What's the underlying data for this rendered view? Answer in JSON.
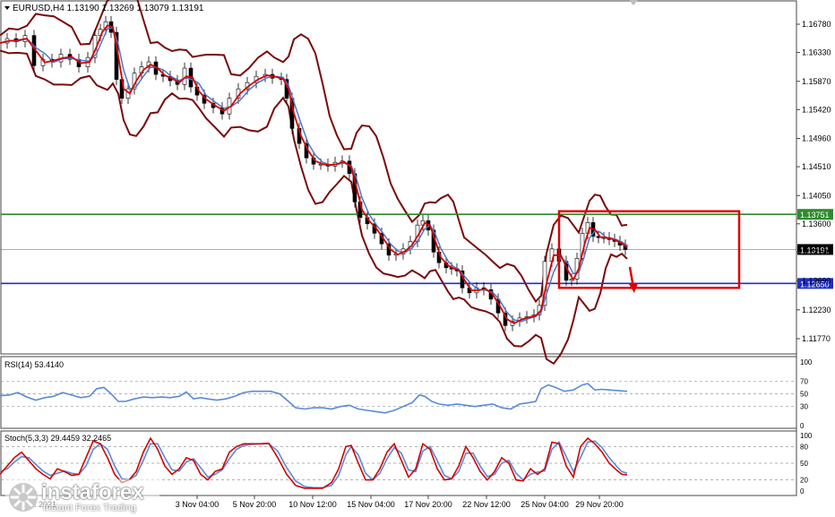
{
  "chart_data": {
    "type": "candlestick",
    "symbol": "EURUSD",
    "timeframe": "H4",
    "header": "EURUSD,H4  1.13190 1.13269 1.13079 1.13191",
    "ylim": [
      1.1157,
      1.1708
    ],
    "y_ticks": [
      "1.16780",
      "1.16330",
      "1.15870",
      "1.15420",
      "1.14960",
      "1.14510",
      "1.14050",
      "1.13600",
      "1.13150",
      "1.12690",
      "1.12230",
      "1.11770"
    ],
    "x_ticks": [
      "29 Oct 2021",
      "3 Nov 04:00",
      "5 Nov 20:00",
      "10 Nov 12:00",
      "15 Nov 04:00",
      "17 Nov 20:00",
      "22 Nov 12:00",
      "25 Nov 04:00",
      "29 Nov 20:00"
    ],
    "x_tick_positions": [
      14,
      220,
      284,
      349,
      414,
      478,
      543,
      608,
      669
    ],
    "price_series": [
      [
        0,
        1.1648
      ],
      [
        10,
        1.1655
      ],
      [
        20,
        1.165
      ],
      [
        30,
        1.166
      ],
      [
        40,
        1.1612
      ],
      [
        50,
        1.1622
      ],
      [
        60,
        1.1618
      ],
      [
        70,
        1.163
      ],
      [
        80,
        1.1622
      ],
      [
        90,
        1.161
      ],
      [
        100,
        1.1625
      ],
      [
        108,
        1.166
      ],
      [
        114,
        1.167
      ],
      [
        120,
        1.1682
      ],
      [
        126,
        1.1665
      ],
      [
        132,
        1.159
      ],
      [
        138,
        1.156
      ],
      [
        145,
        1.1575
      ],
      [
        152,
        1.16
      ],
      [
        160,
        1.161
      ],
      [
        168,
        1.1618
      ],
      [
        176,
        1.1598
      ],
      [
        184,
        1.1595
      ],
      [
        192,
        1.1588
      ],
      [
        200,
        1.1582
      ],
      [
        208,
        1.1608
      ],
      [
        215,
        1.1578
      ],
      [
        222,
        1.1565
      ],
      [
        230,
        1.1552
      ],
      [
        240,
        1.1545
      ],
      [
        250,
        1.1535
      ],
      [
        258,
        1.156
      ],
      [
        268,
        1.1575
      ],
      [
        278,
        1.1585
      ],
      [
        288,
        1.1595
      ],
      [
        298,
        1.1598
      ],
      [
        306,
        1.1592
      ],
      [
        316,
        1.159
      ],
      [
        322,
        1.156
      ],
      [
        328,
        1.1512
      ],
      [
        336,
        1.1488
      ],
      [
        344,
        1.1465
      ],
      [
        352,
        1.1455
      ],
      [
        360,
        1.1455
      ],
      [
        368,
        1.1452
      ],
      [
        376,
        1.1458
      ],
      [
        384,
        1.146
      ],
      [
        392,
        1.144
      ],
      [
        398,
        1.1395
      ],
      [
        404,
        1.137
      ],
      [
        412,
        1.136
      ],
      [
        420,
        1.1345
      ],
      [
        428,
        1.1328
      ],
      [
        436,
        1.131
      ],
      [
        444,
        1.1312
      ],
      [
        452,
        1.132
      ],
      [
        460,
        1.1332
      ],
      [
        468,
        1.1358
      ],
      [
        474,
        1.1365
      ],
      [
        480,
        1.135
      ],
      [
        486,
        1.1315
      ],
      [
        492,
        1.1298
      ],
      [
        500,
        1.129
      ],
      [
        506,
        1.1288
      ],
      [
        512,
        1.1285
      ],
      [
        518,
        1.1258
      ],
      [
        526,
        1.125
      ],
      [
        534,
        1.1258
      ],
      [
        542,
        1.1255
      ],
      [
        550,
        1.124
      ],
      [
        558,
        1.1218
      ],
      [
        566,
        1.1198
      ],
      [
        574,
        1.1205
      ],
      [
        582,
        1.121
      ],
      [
        590,
        1.1212
      ],
      [
        598,
        1.1215
      ],
      [
        604,
        1.123
      ],
      [
        610,
        1.13
      ],
      [
        618,
        1.132
      ],
      [
        626,
        1.13
      ],
      [
        634,
        1.127
      ],
      [
        640,
        1.1272
      ],
      [
        646,
        1.1305
      ],
      [
        652,
        1.1345
      ],
      [
        658,
        1.1362
      ],
      [
        664,
        1.134
      ],
      [
        670,
        1.1338
      ],
      [
        676,
        1.1338
      ],
      [
        682,
        1.1335
      ],
      [
        688,
        1.1332
      ],
      [
        694,
        1.1326
      ],
      [
        700,
        1.1319
      ]
    ],
    "horizontal_levels": [
      {
        "value": 1.13751,
        "label": "1.13751",
        "color": "#2e8b2e"
      },
      {
        "value": 1.1265,
        "label": "1.12650",
        "color": "#1f2ec8"
      },
      {
        "value": 1.13191,
        "label": "1.13191",
        "color": "#000000"
      }
    ],
    "indicators": [
      "Bollinger Bands",
      "moving average (red)",
      "moving average (blue)"
    ],
    "colors": {
      "bollinger": "#7a0a0a",
      "ma_fast": "#d40000",
      "ma_slow": "#4a78c8",
      "annotation": "#e00000",
      "support": "#1f2ec8",
      "resistance": "#2e8b2e"
    },
    "annotation": {
      "type": "rectangle_and_down_arrow",
      "from_x": 624,
      "to_x": 825,
      "from_value": 1.138,
      "to_value": 1.1258,
      "color": "#e00000"
    },
    "rsi": {
      "label": "RSI(14) 53.4140",
      "ylim": [
        0,
        100
      ],
      "axis_labels": [
        "100",
        "70",
        "50",
        "30",
        "0"
      ],
      "levels": [
        70,
        50,
        30
      ],
      "color": "#5a8ad8",
      "values": [
        [
          0,
          47
        ],
        [
          10,
          48
        ],
        [
          20,
          52
        ],
        [
          30,
          45
        ],
        [
          40,
          40
        ],
        [
          50,
          44
        ],
        [
          60,
          46
        ],
        [
          70,
          52
        ],
        [
          80,
          48
        ],
        [
          90,
          44
        ],
        [
          100,
          46
        ],
        [
          108,
          58
        ],
        [
          116,
          60
        ],
        [
          124,
          50
        ],
        [
          132,
          38
        ],
        [
          140,
          38
        ],
        [
          150,
          42
        ],
        [
          160,
          45
        ],
        [
          170,
          44
        ],
        [
          180,
          45
        ],
        [
          190,
          44
        ],
        [
          200,
          46
        ],
        [
          208,
          53
        ],
        [
          216,
          42
        ],
        [
          224,
          44
        ],
        [
          232,
          42
        ],
        [
          242,
          40
        ],
        [
          252,
          42
        ],
        [
          262,
          46
        ],
        [
          272,
          52
        ],
        [
          282,
          54
        ],
        [
          292,
          54
        ],
        [
          302,
          54
        ],
        [
          312,
          50
        ],
        [
          322,
          38
        ],
        [
          330,
          28
        ],
        [
          340,
          26
        ],
        [
          350,
          28
        ],
        [
          360,
          28
        ],
        [
          370,
          26
        ],
        [
          380,
          30
        ],
        [
          390,
          32
        ],
        [
          400,
          26
        ],
        [
          410,
          24
        ],
        [
          420,
          22
        ],
        [
          430,
          20
        ],
        [
          440,
          24
        ],
        [
          450,
          30
        ],
        [
          460,
          36
        ],
        [
          468,
          48
        ],
        [
          474,
          46
        ],
        [
          482,
          38
        ],
        [
          490,
          34
        ],
        [
          500,
          32
        ],
        [
          510,
          34
        ],
        [
          520,
          32
        ],
        [
          530,
          30
        ],
        [
          540,
          32
        ],
        [
          550,
          34
        ],
        [
          560,
          28
        ],
        [
          570,
          26
        ],
        [
          580,
          34
        ],
        [
          590,
          36
        ],
        [
          598,
          38
        ],
        [
          604,
          58
        ],
        [
          612,
          64
        ],
        [
          620,
          60
        ],
        [
          630,
          54
        ],
        [
          640,
          56
        ],
        [
          650,
          64
        ],
        [
          656,
          66
        ],
        [
          664,
          56
        ],
        [
          672,
          57
        ],
        [
          680,
          56
        ],
        [
          690,
          55
        ],
        [
          700,
          54
        ]
      ]
    },
    "stochastic": {
      "label": "Stoch(5,3,3) 29.4459 32.2465",
      "ylim": [
        0,
        100
      ],
      "axis_labels": [
        "100",
        "80",
        "50",
        "20",
        "0"
      ],
      "levels": [
        80,
        50,
        20
      ],
      "main_color": "#d40000",
      "signal_color": "#5a8ad8",
      "main_values": [
        [
          0,
          30
        ],
        [
          8,
          45
        ],
        [
          16,
          60
        ],
        [
          24,
          70
        ],
        [
          32,
          55
        ],
        [
          40,
          40
        ],
        [
          48,
          30
        ],
        [
          56,
          22
        ],
        [
          64,
          40
        ],
        [
          72,
          35
        ],
        [
          80,
          28
        ],
        [
          88,
          30
        ],
        [
          96,
          60
        ],
        [
          104,
          90
        ],
        [
          112,
          85
        ],
        [
          120,
          60
        ],
        [
          128,
          30
        ],
        [
          136,
          15
        ],
        [
          144,
          20
        ],
        [
          152,
          35
        ],
        [
          160,
          70
        ],
        [
          168,
          95
        ],
        [
          176,
          75
        ],
        [
          184,
          45
        ],
        [
          192,
          30
        ],
        [
          200,
          40
        ],
        [
          208,
          60
        ],
        [
          216,
          55
        ],
        [
          224,
          30
        ],
        [
          232,
          20
        ],
        [
          240,
          35
        ],
        [
          248,
          40
        ],
        [
          256,
          70
        ],
        [
          264,
          80
        ],
        [
          272,
          85
        ],
        [
          280,
          85
        ],
        [
          290,
          85
        ],
        [
          300,
          86
        ],
        [
          310,
          60
        ],
        [
          320,
          30
        ],
        [
          330,
          10
        ],
        [
          340,
          5
        ],
        [
          350,
          5
        ],
        [
          360,
          5
        ],
        [
          370,
          15
        ],
        [
          378,
          40
        ],
        [
          386,
          80
        ],
        [
          392,
          82
        ],
        [
          400,
          50
        ],
        [
          408,
          20
        ],
        [
          416,
          20
        ],
        [
          424,
          40
        ],
        [
          432,
          70
        ],
        [
          440,
          85
        ],
        [
          448,
          55
        ],
        [
          456,
          25
        ],
        [
          464,
          40
        ],
        [
          472,
          85
        ],
        [
          480,
          75
        ],
        [
          488,
          40
        ],
        [
          496,
          20
        ],
        [
          504,
          22
        ],
        [
          512,
          45
        ],
        [
          520,
          80
        ],
        [
          528,
          60
        ],
        [
          536,
          35
        ],
        [
          544,
          20
        ],
        [
          552,
          35
        ],
        [
          560,
          60
        ],
        [
          568,
          50
        ],
        [
          576,
          20
        ],
        [
          584,
          18
        ],
        [
          592,
          40
        ],
        [
          600,
          30
        ],
        [
          608,
          40
        ],
        [
          616,
          88
        ],
        [
          624,
          85
        ],
        [
          632,
          45
        ],
        [
          640,
          25
        ],
        [
          648,
          80
        ],
        [
          656,
          95
        ],
        [
          664,
          85
        ],
        [
          672,
          70
        ],
        [
          680,
          50
        ],
        [
          688,
          38
        ],
        [
          694,
          30
        ],
        [
          700,
          29
        ]
      ],
      "signal_values": [
        [
          0,
          35
        ],
        [
          8,
          40
        ],
        [
          16,
          52
        ],
        [
          24,
          62
        ],
        [
          32,
          60
        ],
        [
          40,
          48
        ],
        [
          48,
          36
        ],
        [
          56,
          28
        ],
        [
          64,
          32
        ],
        [
          72,
          36
        ],
        [
          80,
          32
        ],
        [
          88,
          30
        ],
        [
          96,
          45
        ],
        [
          104,
          75
        ],
        [
          112,
          85
        ],
        [
          120,
          75
        ],
        [
          128,
          45
        ],
        [
          136,
          22
        ],
        [
          144,
          20
        ],
        [
          152,
          28
        ],
        [
          160,
          55
        ],
        [
          168,
          85
        ],
        [
          176,
          85
        ],
        [
          184,
          60
        ],
        [
          192,
          38
        ],
        [
          200,
          36
        ],
        [
          208,
          52
        ],
        [
          216,
          58
        ],
        [
          224,
          42
        ],
        [
          232,
          25
        ],
        [
          240,
          30
        ],
        [
          248,
          38
        ],
        [
          256,
          58
        ],
        [
          264,
          75
        ],
        [
          272,
          82
        ],
        [
          280,
          84
        ],
        [
          290,
          85
        ],
        [
          300,
          85
        ],
        [
          310,
          72
        ],
        [
          320,
          42
        ],
        [
          330,
          18
        ],
        [
          340,
          8
        ],
        [
          350,
          6
        ],
        [
          360,
          6
        ],
        [
          370,
          10
        ],
        [
          378,
          28
        ],
        [
          386,
          65
        ],
        [
          392,
          80
        ],
        [
          400,
          65
        ],
        [
          408,
          32
        ],
        [
          416,
          20
        ],
        [
          424,
          32
        ],
        [
          432,
          58
        ],
        [
          440,
          78
        ],
        [
          448,
          68
        ],
        [
          456,
          38
        ],
        [
          464,
          35
        ],
        [
          472,
          72
        ],
        [
          480,
          80
        ],
        [
          488,
          55
        ],
        [
          496,
          28
        ],
        [
          504,
          22
        ],
        [
          512,
          35
        ],
        [
          520,
          68
        ],
        [
          528,
          68
        ],
        [
          536,
          45
        ],
        [
          544,
          26
        ],
        [
          552,
          30
        ],
        [
          560,
          50
        ],
        [
          568,
          55
        ],
        [
          576,
          32
        ],
        [
          584,
          20
        ],
        [
          592,
          30
        ],
        [
          600,
          34
        ],
        [
          608,
          36
        ],
        [
          616,
          75
        ],
        [
          624,
          88
        ],
        [
          632,
          62
        ],
        [
          640,
          35
        ],
        [
          648,
          60
        ],
        [
          656,
          88
        ],
        [
          664,
          90
        ],
        [
          672,
          78
        ],
        [
          680,
          60
        ],
        [
          688,
          45
        ],
        [
          694,
          35
        ],
        [
          700,
          32
        ]
      ]
    }
  },
  "watermark": {
    "brand": "instaforex",
    "tagline": "Instant Forex Trading"
  }
}
